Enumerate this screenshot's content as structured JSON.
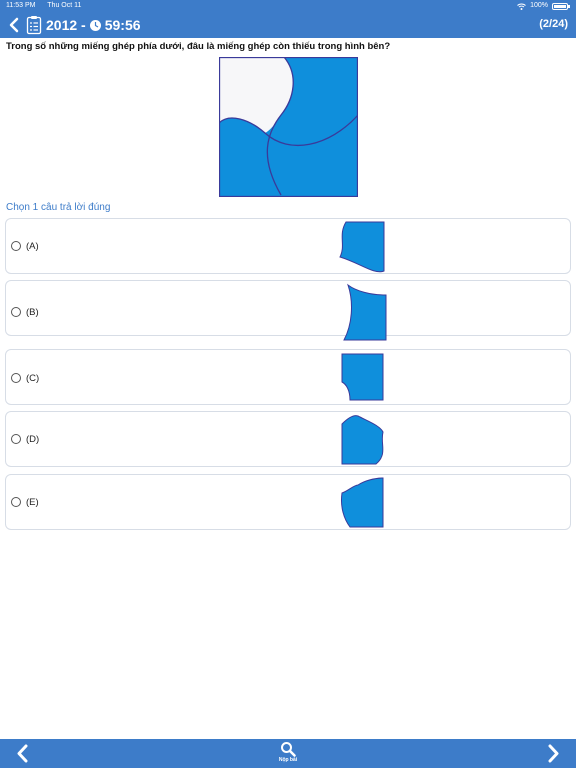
{
  "status_bar": {
    "time": "11:53 PM",
    "date": "Thu Oct 11",
    "battery": "100%"
  },
  "header": {
    "title_prefix": "2012 -",
    "timer": "59:56",
    "progress": "(2/24)"
  },
  "question": {
    "text": "Trong số những miếng ghép phía dưới, đâu là miếng ghép còn thiếu trong hình bên?"
  },
  "instruction": "Chọn 1 câu trả lời đúng",
  "options": [
    {
      "label": "(A)"
    },
    {
      "label": "(B)"
    },
    {
      "label": "(C)"
    },
    {
      "label": "(D)"
    },
    {
      "label": "(E)"
    }
  ],
  "footer": {
    "submit_label": "Nộp bài"
  },
  "colors": {
    "accent": "#3d7cc9",
    "piece_fill": "#0f8fdc",
    "piece_stroke": "#3a3a9a",
    "border": "#d7dde6"
  },
  "icons": {
    "back": "chevron-left-icon",
    "document": "clipboard-list-icon",
    "timer": "clock-icon",
    "prev": "chevron-left-icon",
    "next": "chevron-right-icon",
    "submit": "search-icon"
  }
}
